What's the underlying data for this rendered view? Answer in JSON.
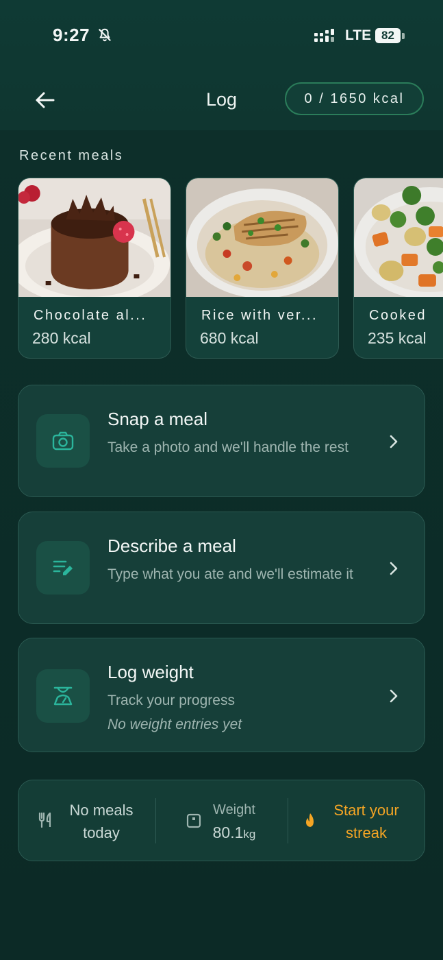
{
  "status_bar": {
    "time": "9:27",
    "network": "LTE",
    "battery": "82"
  },
  "header": {
    "title": "Log",
    "kcal_progress": "0 / 1650 kcal"
  },
  "recent": {
    "label": "Recent meals",
    "meals": [
      {
        "name": "Chocolate al...",
        "kcal": "280 kcal"
      },
      {
        "name": "Rice with ver...",
        "kcal": "680 kcal"
      },
      {
        "name": "Cooked",
        "kcal": "235 kcal"
      }
    ]
  },
  "actions": {
    "snap": {
      "title": "Snap a meal",
      "subtitle": "Take a photo and we'll handle the rest"
    },
    "describe": {
      "title": "Describe a meal",
      "subtitle": "Type what you ate and we'll estimate it"
    },
    "weight": {
      "title": "Log weight",
      "subtitle": "Track your progress",
      "note": "No weight entries yet"
    }
  },
  "summary": {
    "meals_line1": "No meals",
    "meals_line2": "today",
    "weight_label": "Weight",
    "weight_value": "80.1",
    "weight_unit": "kg",
    "streak_line1": "Start your",
    "streak_line2": "streak"
  },
  "icons": {
    "back": "arrow-left-icon",
    "camera": "camera-icon",
    "describe": "edit-list-icon",
    "scale": "scale-icon",
    "chevron": "chevron-right-icon",
    "utensils": "utensils-icon",
    "weight": "weight-icon",
    "flame": "flame-icon"
  },
  "colors": {
    "accent": "#2bb59c",
    "streak": "#f5a524",
    "pill_border": "#2b7d5a"
  }
}
